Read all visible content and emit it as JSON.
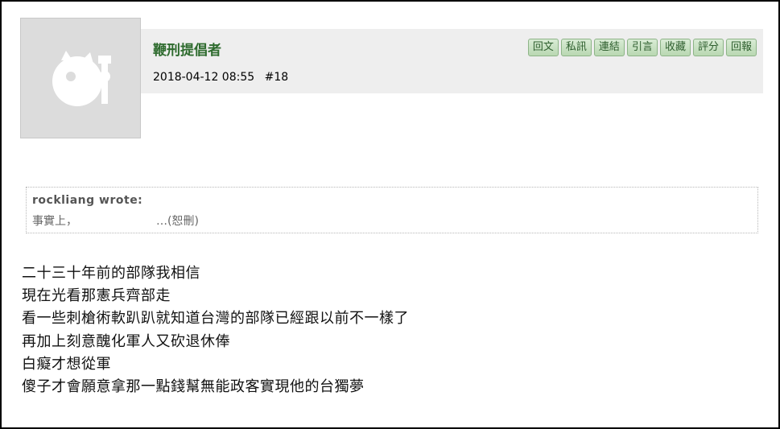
{
  "post": {
    "author": "鞭刑提倡者",
    "date": "2018-04-12 08:55",
    "floor": "#18"
  },
  "actions": [
    "回文",
    "私訊",
    "連結",
    "引言",
    "收藏",
    "評分",
    "回報"
  ],
  "quote": {
    "author": "rockliang wrote:",
    "text_start": "事實上，",
    "text_end": "…(恕刪)"
  },
  "content_lines": [
    "二十三十年前的部隊我相信",
    "現在光看那憲兵齊部走",
    "看一些刺槍術軟趴趴就知道台灣的部隊已經跟以前不一樣了",
    "再加上刻意醜化軍人又砍退休俸",
    "白癡才想從軍",
    "傻子才會願意拿那一點錢幫無能政客實現他的台獨夢"
  ],
  "avatar": {
    "icon": "default-avatar-icon"
  }
}
